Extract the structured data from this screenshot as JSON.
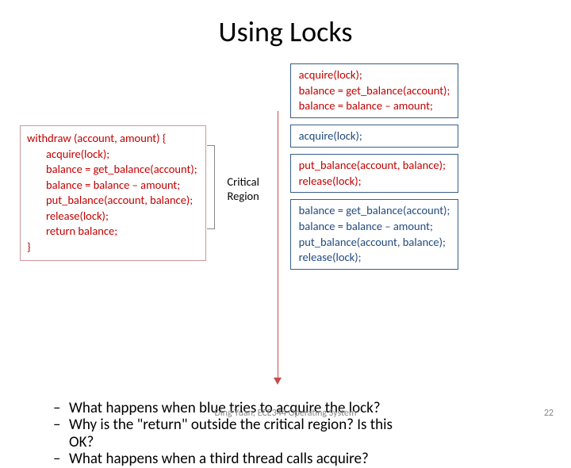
{
  "title": "Using Locks",
  "left_code": {
    "l0": "withdraw (account, amount) {",
    "l1": "acquire(lock);",
    "l2": "balance = get_balance(account);",
    "l3": "balance = balance – amount;",
    "l4": "put_balance(account, balance);",
    "l5": "release(lock);",
    "l6": "return balance;",
    "l7": "}"
  },
  "critical_label_1": "Critical",
  "critical_label_2": "Region",
  "box1": {
    "a": "acquire(lock);",
    "b": "balance = get_balance(account);",
    "c": "balance = balance – amount;"
  },
  "box2": {
    "a": "acquire(lock);"
  },
  "box3": {
    "a": "put_balance(account, balance);",
    "b": "release(lock);"
  },
  "box4": {
    "a": "balance = get_balance(account);",
    "b": "balance = balance – amount;",
    "c": "put_balance(account, balance);",
    "d": "release(lock);"
  },
  "bullets": {
    "q1": "What happens when blue tries to acquire the lock?",
    "q2a": "Why is the \"return\" outside the critical region? Is this",
    "q2b": "OK?",
    "q3": "What happens when a third thread calls acquire?"
  },
  "footer": "Ding Yuan, ECE344 Operating System",
  "page": "22"
}
